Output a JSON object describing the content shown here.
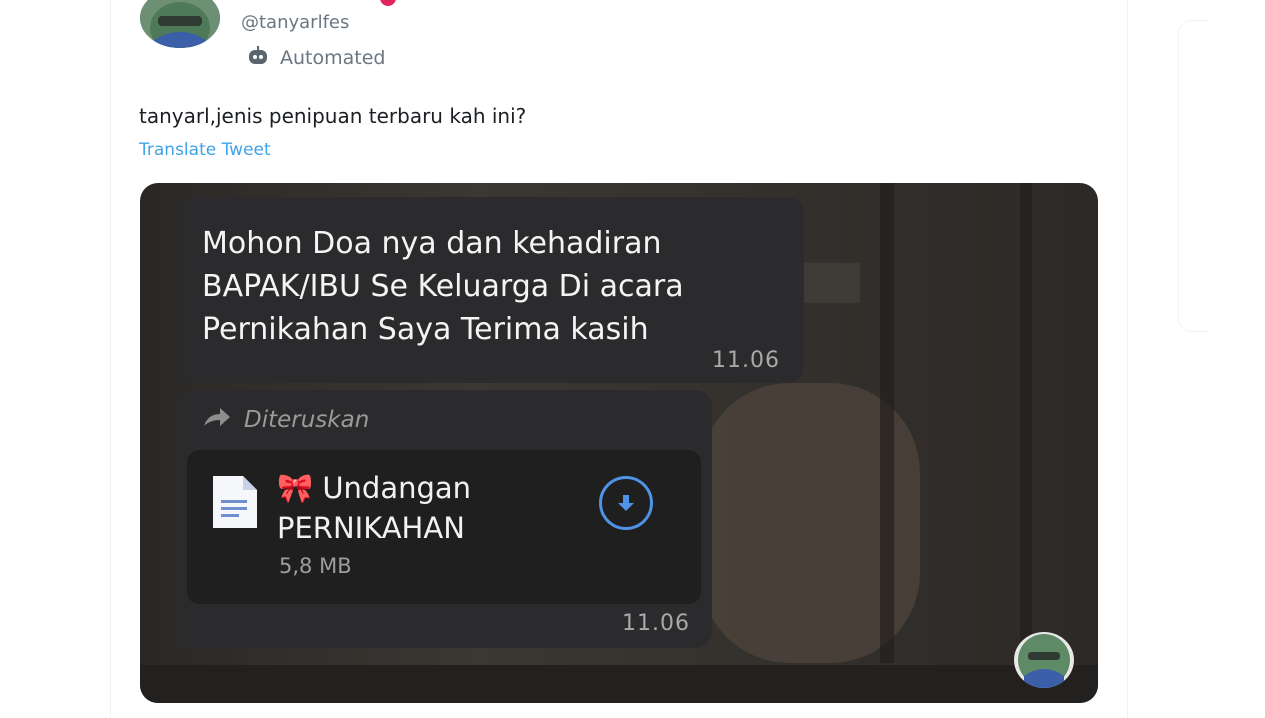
{
  "tweet": {
    "handle": "@tanyarlfes",
    "automated_label": "Automated",
    "text": "tanyarl,jenis penipuan terbaru kah ini?",
    "translate_label": "Translate Tweet"
  },
  "chat": {
    "message1": {
      "text": "Mohon Doa nya dan kehadiran BAPAK/IBU Se Keluarga Di acara Pernikahan Saya Terima kasih",
      "time": "11.06"
    },
    "message2": {
      "forwarded_label": "Diteruskan",
      "file_emoji": "🎀",
      "file_name": "Undangan PERNIKAHAN",
      "file_size": "5,8 MB",
      "time": "11.06"
    }
  },
  "colors": {
    "link": "#3fa3e8",
    "bubble": "#2b2b2d",
    "download_accent": "#4f93e6"
  },
  "icons": [
    "robot-icon",
    "forward-arrow-icon",
    "document-icon",
    "download-icon"
  ]
}
